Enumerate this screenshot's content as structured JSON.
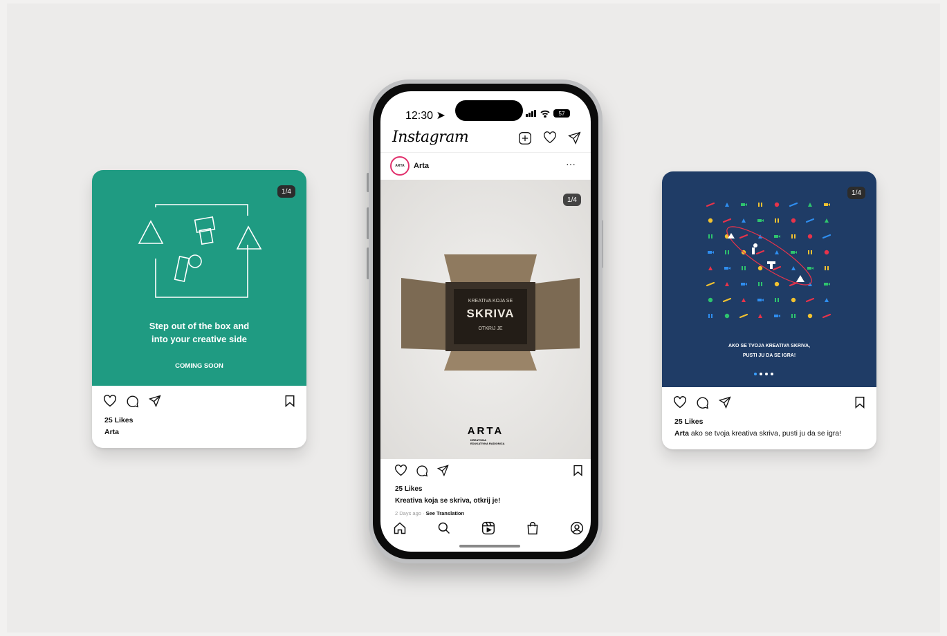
{
  "left_card": {
    "counter": "1/4",
    "headline": "Step out of the box and\ninto your creative side",
    "subline": "COMING SOON",
    "likes": "25 Likes",
    "username": "Arta",
    "brand_color": "#1f9b82"
  },
  "phone": {
    "status": {
      "time": "12:30",
      "battery": "57"
    },
    "app_title": "Instagram",
    "post": {
      "username": "Arta",
      "avatar_text": "ARTA",
      "counter": "1/4",
      "box_line1": "KREATIVA KOJA SE",
      "box_big": "SKRIVA",
      "box_line2": "OTKRIJ JE",
      "logo": "ARTA",
      "logo_sub": "KREATIVNA\nEDUKATIVNA RADIONICA",
      "likes": "25 Likes",
      "caption": "Kreativa koja se skriva, otkrij je!",
      "time_ago": "2 Days ago",
      "separator": " · ",
      "see_translation": "See Translation"
    }
  },
  "right_card": {
    "counter": "1/4",
    "text_line1": "AKO SE TVOJA KREATIVA SKRIVA,",
    "text_line2": "PUSTI JU DA SE IGRA!",
    "likes": "25 Likes",
    "username": "Arta",
    "caption": " ako se tvoja kreativa skriva, pusti ju da se igra!",
    "brand_color": "#1f3c66"
  },
  "colors": {
    "red": "#e8334a",
    "yellow": "#f2c230",
    "green": "#2ec46e",
    "blue": "#2f8ef0",
    "ig_ring": "#e1306c"
  }
}
